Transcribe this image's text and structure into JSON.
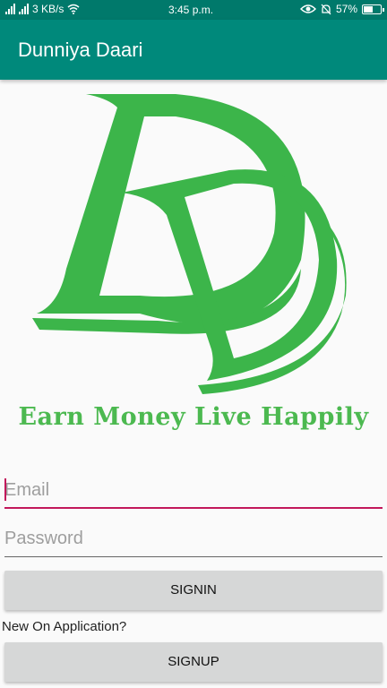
{
  "status_bar": {
    "network_speed": "3 KB/s",
    "time": "3:45 p.m.",
    "battery_percent": "57%",
    "battery_level": 0.57
  },
  "app_bar": {
    "title": "Dunniya Daari"
  },
  "logo": {
    "letters": "DD",
    "color": "#3cb54a"
  },
  "tagline": "Earn Money Live Happily",
  "form": {
    "email_placeholder": "Email",
    "password_placeholder": "Password",
    "signin_label": "SIGNIN",
    "new_user_prompt": "New On Application?",
    "signup_label": "SIGNUP"
  },
  "colors": {
    "primary": "#00897b",
    "primary_dark": "#00796b",
    "accent": "#c2185b",
    "logo_green": "#3cb54a"
  }
}
